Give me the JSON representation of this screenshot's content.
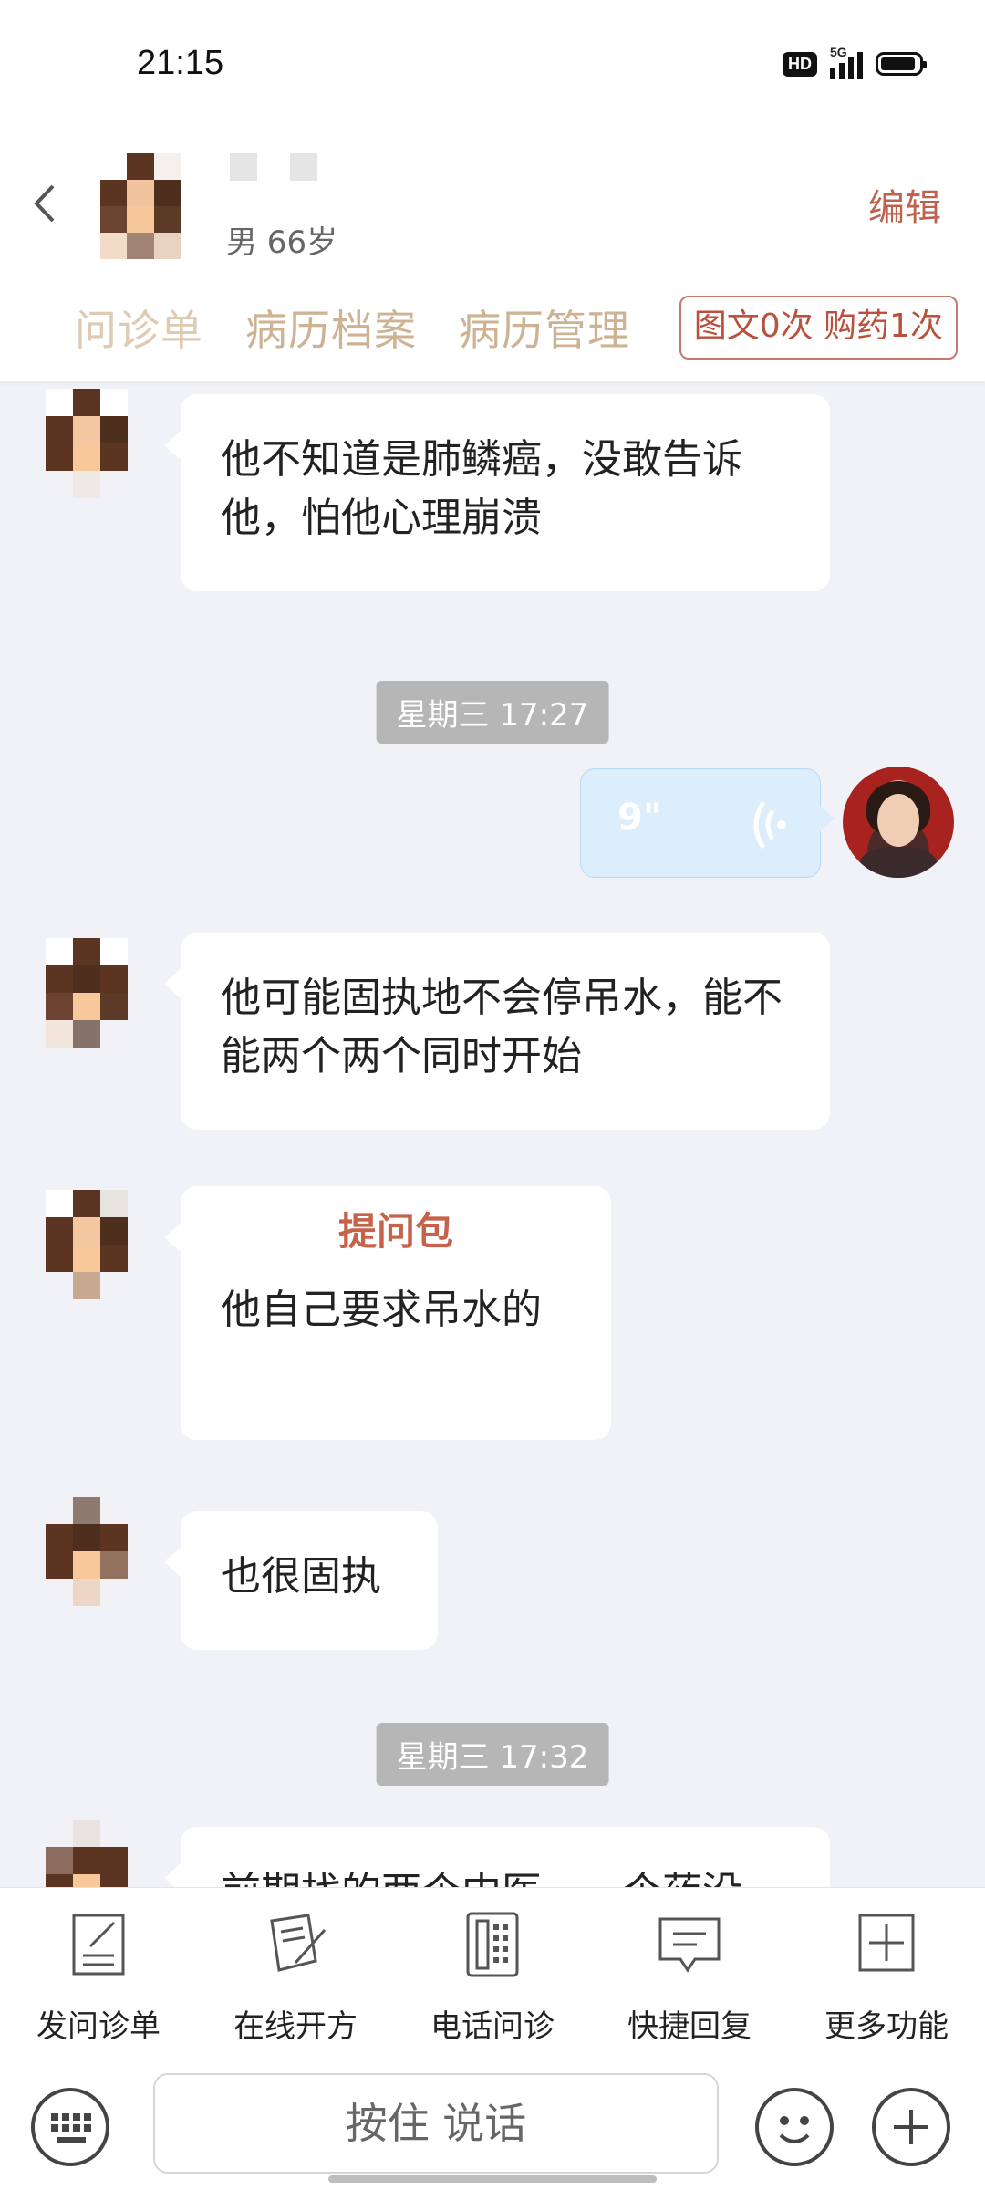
{
  "status_bar": {
    "time": "21:15",
    "hd": "HD",
    "network": "5G"
  },
  "header": {
    "patient_info": "男 66岁",
    "edit_label": "编辑",
    "tabs": [
      {
        "label": "问诊单"
      },
      {
        "label": "病历档案"
      },
      {
        "label": "病历管理"
      }
    ],
    "consult_badge": "图文0次 购药1次"
  },
  "chat": {
    "messages": [
      {
        "sender": "patient",
        "text": "他不知道是肺鳞癌，没敢告诉他，怕他心理崩溃"
      },
      {
        "type": "timestamp",
        "text": "星期三 17:27"
      },
      {
        "sender": "doctor",
        "type": "voice",
        "duration": "9\""
      },
      {
        "sender": "patient",
        "text": "他可能固执地不会停吊水，能不能两个两个同时开始"
      },
      {
        "sender": "patient",
        "tag": "提问包",
        "text": "他自己要求吊水的"
      },
      {
        "sender": "patient",
        "text": "也很固执"
      },
      {
        "type": "timestamp",
        "text": "星期三 17:32"
      },
      {
        "sender": "patient",
        "text": "前期找的两个中医，一个药没"
      }
    ]
  },
  "toolbar": {
    "items": [
      {
        "label": "发问诊单",
        "icon": "form-icon"
      },
      {
        "label": "在线开方",
        "icon": "prescription-icon"
      },
      {
        "label": "电话问诊",
        "icon": "phone-icon"
      },
      {
        "label": "快捷回复",
        "icon": "quick-reply-icon"
      },
      {
        "label": "更多功能",
        "icon": "more-icon"
      }
    ]
  },
  "input_bar": {
    "hold_to_talk": "按住 说话"
  },
  "colors": {
    "accent": "#c0614e",
    "tab_text": "#cdb394",
    "chat_bg": "#f1f2f7",
    "voice_bubble": "#dcedfb"
  }
}
